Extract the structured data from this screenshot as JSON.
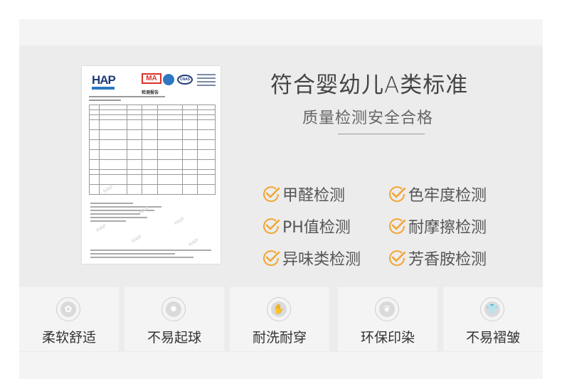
{
  "hero": {
    "title": "符合婴幼儿A类标准",
    "subtitle": "质量检测安全合格"
  },
  "report": {
    "logo_text": "HAP",
    "ma_text": "MA",
    "cnas_text": "CNAS",
    "title": "检测报告",
    "watermark": "HAP"
  },
  "checks": [
    {
      "label": "甲醛检测"
    },
    {
      "label": "色牢度检测"
    },
    {
      "label": "PH值检测"
    },
    {
      "label": "耐摩擦检测"
    },
    {
      "label": "异味类检测"
    },
    {
      "label": "芳香胺检测"
    }
  ],
  "check_icon": "check-circle-icon",
  "accent": "#f2a530",
  "features": [
    {
      "label": "柔软舒适",
      "icon": "cotton-icon"
    },
    {
      "label": "不易起球",
      "icon": "gear-badge-icon"
    },
    {
      "label": "耐洗耐穿",
      "icon": "glove-icon"
    },
    {
      "label": "环保印染",
      "icon": "leaf-icon"
    },
    {
      "label": "不易褶皱",
      "icon": "tshirt-icon"
    }
  ]
}
